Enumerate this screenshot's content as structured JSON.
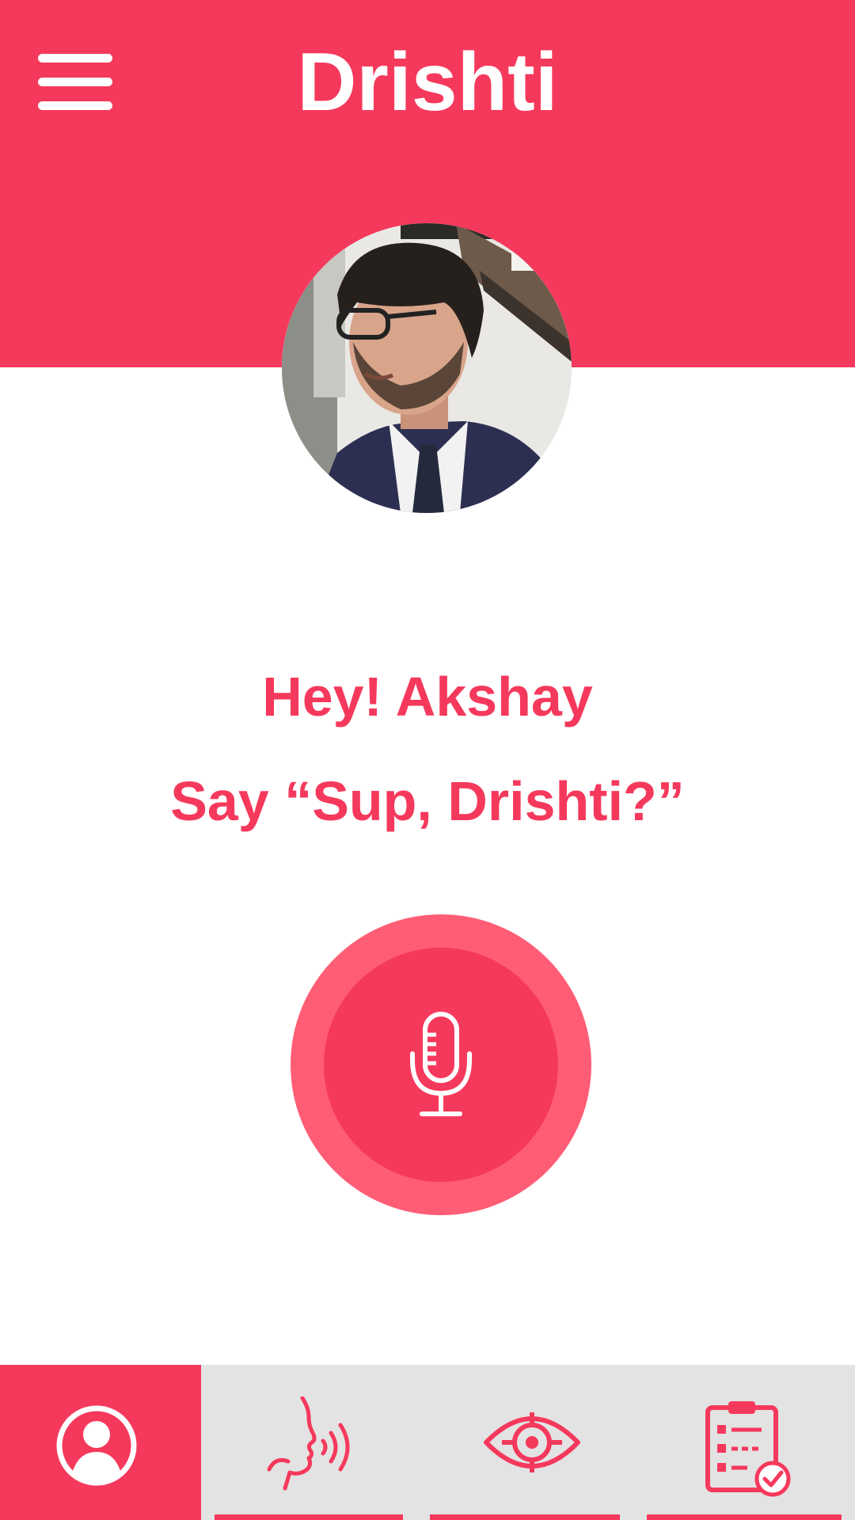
{
  "app": {
    "title": "Drishti"
  },
  "colors": {
    "primary": "#f5395c",
    "mic_ring": "#ff5d76",
    "nav_bg": "#e3e3e3",
    "white": "#ffffff"
  },
  "header": {
    "menu_icon": "hamburger-menu-icon"
  },
  "profile": {
    "avatar_icon": "user-photo-avatar"
  },
  "main": {
    "greeting": "Hey! Akshay",
    "prompt": "Say “Sup, Drishti?”",
    "mic_icon": "microphone-icon"
  },
  "bottom_nav": {
    "items": [
      {
        "icon": "profile-icon",
        "active": true
      },
      {
        "icon": "speech-icon",
        "active": false
      },
      {
        "icon": "eye-target-icon",
        "active": false
      },
      {
        "icon": "checklist-icon",
        "active": false
      }
    ]
  }
}
